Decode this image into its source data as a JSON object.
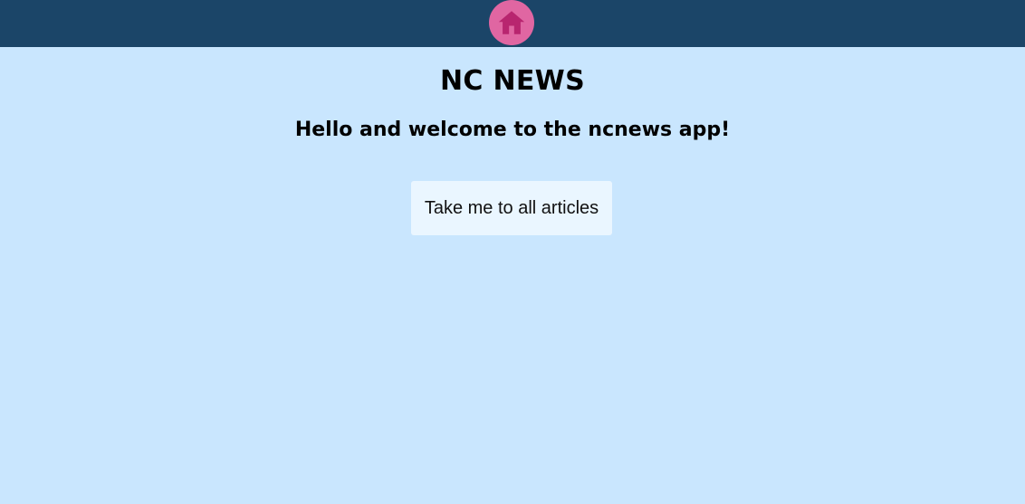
{
  "header": {
    "home_icon": "home-icon",
    "home_bg_color": "#e066a2",
    "home_icon_color": "#b8256f",
    "bar_color": "#1b4568"
  },
  "main": {
    "title": "NC NEWS",
    "subtitle": "Hello and welcome to the ncnews app!",
    "cta_label": "Take me to all articles",
    "background_color": "#c9e6fe"
  }
}
